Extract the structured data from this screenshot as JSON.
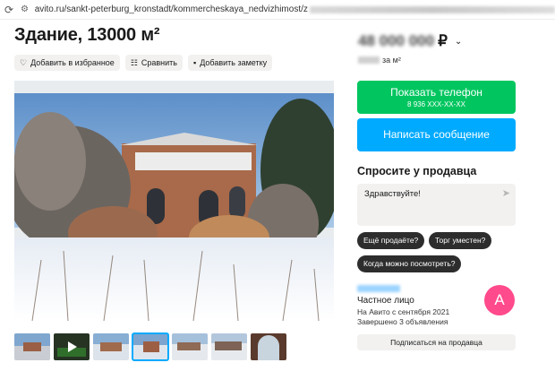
{
  "browser": {
    "url": "avito.ru/sankt-peterburg_kronstadt/kommercheskaya_nedvizhimost/z",
    "reload_icon": "reload-icon",
    "site_icon": "tune-icon"
  },
  "listing": {
    "title": "Здание, 13000 м²",
    "actions": [
      {
        "label": "Добавить в избранное",
        "icon": "heart-icon"
      },
      {
        "label": "Сравнить",
        "icon": "compare-icon"
      },
      {
        "label": "Добавить заметку",
        "icon": "note-icon"
      }
    ],
    "thumbnails_count": 7,
    "selected_thumbnail": 3,
    "video_thumbnail": 2
  },
  "sidebar": {
    "price_obscured": "48 000 000",
    "currency": "₽",
    "per_m_suffix": "за м²",
    "phone_button": {
      "label": "Показать телефон",
      "number": "8 936 XXX-XX-XX"
    },
    "message_button": "Написать сообщение",
    "ask": {
      "title": "Спросите у продавца",
      "input_value": "Здравствуйте!",
      "questions": [
        "Ещё продаёте?",
        "Торг уместен?",
        "Когда можно посмотреть?"
      ]
    },
    "seller": {
      "type": "Частное лицо",
      "since": "На Авито с сентября 2021",
      "completed": "Завершено 3 объявления",
      "avatar_letter": "A",
      "avatar_color": "#ff4a8b"
    },
    "subscribe_button": "Подписаться на продавца"
  },
  "colors": {
    "green": "#01c65f",
    "blue": "#00aaff",
    "chip_bg": "#f2f1f0"
  }
}
